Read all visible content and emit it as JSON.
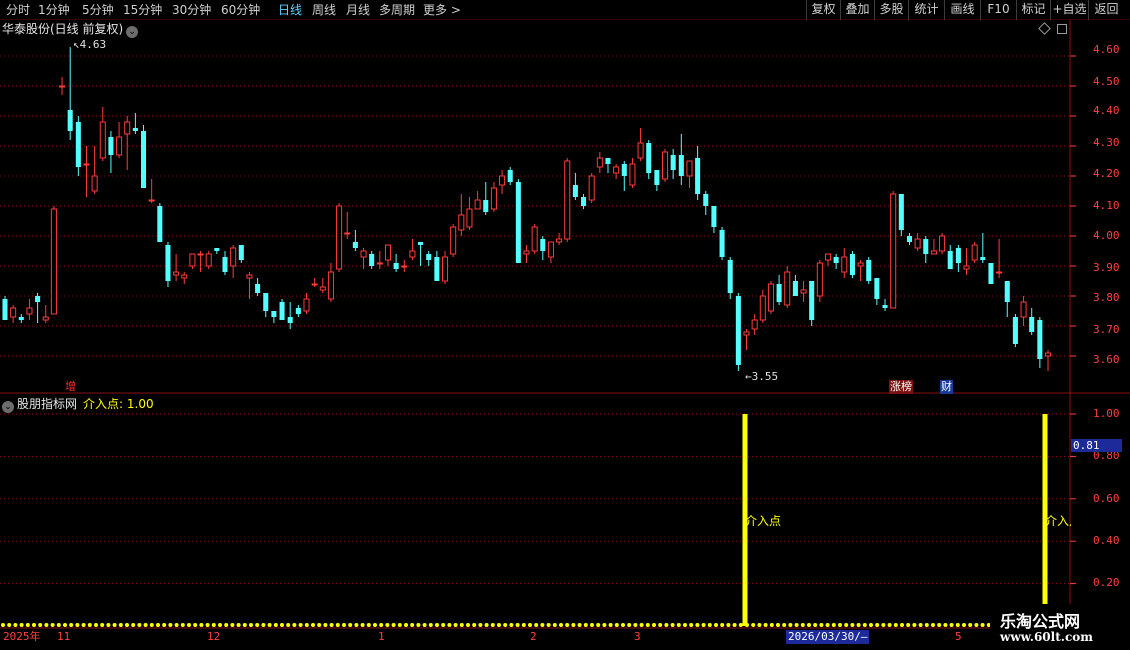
{
  "toolbar": {
    "periods": [
      "分时",
      "1分钟",
      "5分钟",
      "15分钟",
      "30分钟",
      "60分钟",
      "日线",
      "周线",
      "月线",
      "多周期",
      "更多 >"
    ],
    "active_period": "日线",
    "buttons": [
      "复权",
      "叠加",
      "多股",
      "统计",
      "画线",
      "F10",
      "标记",
      "+自选",
      "返回"
    ]
  },
  "stock_title": "华泰股份(日线 前复权)",
  "price_labels": {
    "high": "4.63",
    "low": "3.55"
  },
  "event_tags": [
    {
      "text": "增",
      "color": "#ff3030",
      "bg": "#000000"
    },
    {
      "text": "涨榜",
      "color": "#ffffff",
      "bg": "#7a1010"
    },
    {
      "text": "财",
      "color": "#ffffff",
      "bg": "#1a3a9a"
    }
  ],
  "indicator": {
    "name": "股朋指标网",
    "value_label": "介入点: 1.00",
    "current_value": "0.81",
    "signal_text": "介入点",
    "signal_text_cut": "介入点",
    "color": "#ffff00"
  },
  "price_axis": [
    "4.60",
    "4.50",
    "4.40",
    "4.30",
    "4.20",
    "4.10",
    "4.00",
    "3.90",
    "3.80",
    "3.70",
    "3.60"
  ],
  "indicator_axis": [
    "1.00",
    "0.80",
    "0.60",
    "0.40",
    "0.20"
  ],
  "dates": [
    "2025年",
    "11",
    "12",
    "1",
    "2",
    "3",
    "2026/03/30/—",
    "5"
  ],
  "watermark": {
    "line1": "乐淘公式网",
    "line2": "www.60lt.com"
  },
  "colors": {
    "up": "#ff3b3b",
    "down": "#54ffff",
    "grid": "#8a1010",
    "signal": "#ffff00"
  },
  "chart_data": {
    "type": "candlestick",
    "title": "华泰股份(日线 前复权)",
    "ylim": [
      3.52,
      4.66
    ],
    "series": [
      {
        "name": "ohlc",
        "values": [
          [
            3.79,
            3.72,
            3.8,
            3.72
          ],
          [
            3.73,
            3.76,
            3.77,
            3.71
          ],
          [
            3.73,
            3.72,
            3.74,
            3.71
          ],
          [
            3.74,
            3.76,
            3.79,
            3.72
          ],
          [
            3.8,
            3.78,
            3.81,
            3.71
          ],
          [
            3.72,
            3.73,
            3.77,
            3.71
          ],
          [
            3.74,
            4.09,
            4.1,
            3.74
          ],
          [
            4.5,
            4.5,
            4.53,
            4.47
          ],
          [
            4.42,
            4.35,
            4.63,
            4.32
          ],
          [
            4.38,
            4.23,
            4.4,
            4.2
          ],
          [
            4.24,
            4.24,
            4.3,
            4.13
          ],
          [
            4.15,
            4.2,
            4.3,
            4.14
          ],
          [
            4.26,
            4.38,
            4.43,
            4.25
          ],
          [
            4.33,
            4.27,
            4.35,
            4.21
          ],
          [
            4.27,
            4.33,
            4.38,
            4.26
          ],
          [
            4.34,
            4.38,
            4.4,
            4.22
          ],
          [
            4.36,
            4.35,
            4.41,
            4.34
          ],
          [
            4.35,
            4.16,
            4.37,
            4.16
          ],
          [
            4.12,
            4.12,
            4.19,
            4.11
          ],
          [
            4.1,
            3.98,
            4.11,
            3.98
          ],
          [
            3.97,
            3.85,
            3.98,
            3.83
          ],
          [
            3.87,
            3.88,
            3.94,
            3.85
          ],
          [
            3.86,
            3.87,
            3.88,
            3.84
          ],
          [
            3.9,
            3.94,
            3.94,
            3.89
          ],
          [
            3.94,
            3.94,
            3.95,
            3.88
          ],
          [
            3.9,
            3.94,
            3.95,
            3.89
          ],
          [
            3.96,
            3.95,
            3.96,
            3.94
          ],
          [
            3.93,
            3.88,
            3.95,
            3.87
          ],
          [
            3.9,
            3.96,
            3.97,
            3.86
          ],
          [
            3.97,
            3.92,
            3.97,
            3.91
          ],
          [
            3.86,
            3.87,
            3.88,
            3.79
          ],
          [
            3.84,
            3.81,
            3.86,
            3.8
          ],
          [
            3.81,
            3.75,
            3.81,
            3.73
          ],
          [
            3.75,
            3.73,
            3.75,
            3.71
          ],
          [
            3.78,
            3.72,
            3.79,
            3.72
          ],
          [
            3.73,
            3.71,
            3.78,
            3.69
          ],
          [
            3.76,
            3.74,
            3.77,
            3.73
          ],
          [
            3.75,
            3.79,
            3.81,
            3.74
          ],
          [
            3.84,
            3.84,
            3.86,
            3.83
          ],
          [
            3.82,
            3.83,
            3.86,
            3.81
          ],
          [
            3.79,
            3.88,
            3.91,
            3.78
          ],
          [
            3.89,
            4.1,
            4.11,
            3.88
          ],
          [
            4.01,
            4.01,
            4.08,
            3.99
          ],
          [
            3.98,
            3.96,
            4.02,
            3.95
          ],
          [
            3.93,
            3.95,
            3.96,
            3.89
          ],
          [
            3.94,
            3.9,
            3.95,
            3.89
          ],
          [
            3.91,
            3.91,
            3.95,
            3.89
          ],
          [
            3.92,
            3.97,
            3.97,
            3.9
          ],
          [
            3.91,
            3.89,
            3.94,
            3.88
          ],
          [
            3.9,
            3.9,
            3.92,
            3.88
          ],
          [
            3.93,
            3.95,
            3.99,
            3.92
          ],
          [
            3.98,
            3.97,
            3.98,
            3.9
          ],
          [
            3.94,
            3.92,
            3.95,
            3.9
          ],
          [
            3.93,
            3.85,
            3.95,
            3.85
          ],
          [
            3.85,
            3.93,
            3.95,
            3.84
          ],
          [
            3.94,
            4.03,
            4.04,
            3.93
          ],
          [
            4.02,
            4.07,
            4.14,
            4.0
          ],
          [
            4.03,
            4.09,
            4.13,
            4.02
          ],
          [
            4.09,
            4.12,
            4.15,
            4.09
          ],
          [
            4.12,
            4.08,
            4.18,
            4.07
          ],
          [
            4.09,
            4.16,
            4.18,
            4.08
          ],
          [
            4.17,
            4.2,
            4.22,
            4.14
          ],
          [
            4.22,
            4.18,
            4.23,
            4.17
          ],
          [
            4.18,
            3.91,
            4.19,
            3.91
          ],
          [
            3.94,
            3.95,
            3.97,
            3.91
          ],
          [
            3.95,
            4.03,
            4.04,
            3.94
          ],
          [
            3.99,
            3.95,
            4.0,
            3.92
          ],
          [
            3.93,
            3.98,
            3.98,
            3.91
          ],
          [
            3.98,
            3.99,
            4.01,
            3.97
          ],
          [
            3.99,
            4.25,
            4.26,
            3.98
          ],
          [
            4.17,
            4.13,
            4.21,
            4.12
          ],
          [
            4.13,
            4.1,
            4.14,
            4.09
          ],
          [
            4.12,
            4.2,
            4.21,
            4.11
          ],
          [
            4.23,
            4.26,
            4.28,
            4.21
          ],
          [
            4.26,
            4.24,
            4.26,
            4.21
          ],
          [
            4.21,
            4.23,
            4.24,
            4.19
          ],
          [
            4.24,
            4.2,
            4.25,
            4.15
          ],
          [
            4.17,
            4.24,
            4.26,
            4.16
          ],
          [
            4.26,
            4.31,
            4.36,
            4.25
          ],
          [
            4.31,
            4.21,
            4.32,
            4.19
          ],
          [
            4.22,
            4.17,
            4.22,
            4.15
          ],
          [
            4.19,
            4.28,
            4.29,
            4.18
          ],
          [
            4.27,
            4.22,
            4.29,
            4.19
          ],
          [
            4.27,
            4.2,
            4.34,
            4.17
          ],
          [
            4.2,
            4.25,
            4.25,
            4.16
          ],
          [
            4.26,
            4.14,
            4.3,
            4.12
          ],
          [
            4.14,
            4.1,
            4.15,
            4.07
          ],
          [
            4.1,
            4.03,
            4.1,
            4.01
          ],
          [
            4.02,
            3.93,
            4.03,
            3.92
          ],
          [
            3.92,
            3.81,
            3.93,
            3.79
          ],
          [
            3.8,
            3.57,
            3.81,
            3.55
          ],
          [
            3.67,
            3.68,
            3.69,
            3.62
          ],
          [
            3.69,
            3.72,
            3.74,
            3.67
          ],
          [
            3.72,
            3.8,
            3.82,
            3.71
          ],
          [
            3.75,
            3.84,
            3.85,
            3.74
          ],
          [
            3.84,
            3.78,
            3.87,
            3.77
          ],
          [
            3.77,
            3.88,
            3.9,
            3.76
          ],
          [
            3.85,
            3.8,
            3.87,
            3.8
          ],
          [
            3.81,
            3.82,
            3.85,
            3.78
          ],
          [
            3.85,
            3.72,
            3.85,
            3.7
          ],
          [
            3.8,
            3.91,
            3.92,
            3.78
          ],
          [
            3.92,
            3.94,
            3.94,
            3.9
          ],
          [
            3.93,
            3.91,
            3.94,
            3.89
          ],
          [
            3.88,
            3.93,
            3.96,
            3.86
          ],
          [
            3.94,
            3.87,
            3.95,
            3.86
          ],
          [
            3.9,
            3.91,
            3.92,
            3.85
          ],
          [
            3.92,
            3.85,
            3.93,
            3.84
          ],
          [
            3.86,
            3.79,
            3.86,
            3.77
          ],
          [
            3.77,
            3.76,
            3.79,
            3.75
          ],
          [
            3.76,
            4.14,
            4.15,
            3.76
          ],
          [
            4.14,
            4.02,
            4.14,
            4.0
          ],
          [
            4.0,
            3.98,
            4.01,
            3.97
          ],
          [
            3.96,
            3.99,
            4.01,
            3.95
          ],
          [
            3.99,
            3.94,
            4.0,
            3.91
          ],
          [
            3.94,
            3.95,
            3.99,
            3.94
          ],
          [
            3.95,
            4.0,
            4.01,
            3.94
          ],
          [
            3.95,
            3.89,
            3.97,
            3.89
          ],
          [
            3.96,
            3.91,
            3.97,
            3.88
          ],
          [
            3.89,
            3.9,
            3.96,
            3.87
          ],
          [
            3.92,
            3.97,
            3.98,
            3.91
          ],
          [
            3.93,
            3.92,
            4.01,
            3.91
          ],
          [
            3.91,
            3.84,
            3.91,
            3.84
          ],
          [
            3.88,
            3.88,
            3.99,
            3.86
          ],
          [
            3.85,
            3.78,
            3.85,
            3.73
          ],
          [
            3.73,
            3.64,
            3.74,
            3.63
          ],
          [
            3.73,
            3.78,
            3.8,
            3.7
          ],
          [
            3.73,
            3.68,
            3.76,
            3.67
          ],
          [
            3.72,
            3.59,
            3.73,
            3.56
          ],
          [
            3.6,
            3.61,
            3.62,
            3.55
          ]
        ]
      },
      {
        "name": "介入点",
        "values": [
          1.0,
          1.0
        ]
      }
    ]
  }
}
